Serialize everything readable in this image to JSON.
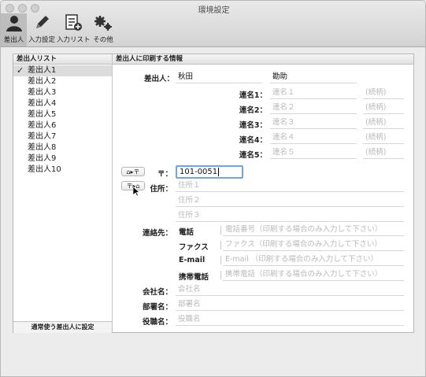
{
  "window": {
    "title": "環境設定"
  },
  "toolbar": [
    {
      "label": "差出人",
      "icon": "person-icon",
      "active": true
    },
    {
      "label": "入力設定",
      "icon": "pencil-icon",
      "active": false
    },
    {
      "label": "入力リスト",
      "icon": "list-add-icon",
      "active": false
    },
    {
      "label": "その他",
      "icon": "gears-icon",
      "active": false
    }
  ],
  "sender_list": {
    "header": "差出人リスト",
    "items": [
      "差出人1",
      "差出人2",
      "差出人3",
      "差出人4",
      "差出人5",
      "差出人6",
      "差出人7",
      "差出人8",
      "差出人9",
      "差出人10"
    ],
    "selected_index": 0,
    "default_button": "通常使う差出人に設定"
  },
  "detail": {
    "header": "差出人に印刷する情報",
    "sender_label": "差出人：",
    "last_name": "秋田",
    "first_name": "勘助",
    "renmei": [
      {
        "label": "連名1：",
        "placeholder": "連名１",
        "honorific": "(続柄)"
      },
      {
        "label": "連名2：",
        "placeholder": "連名２",
        "honorific": "(続柄)"
      },
      {
        "label": "連名3：",
        "placeholder": "連名３",
        "honorific": "(続柄)"
      },
      {
        "label": "連名4：",
        "placeholder": "連名４",
        "honorific": "(続柄)"
      },
      {
        "label": "連名5：",
        "placeholder": "連名５",
        "honorific": "(続柄)"
      }
    ],
    "zip_label": "〒：",
    "zip_value": "101-0051",
    "addr_to_zip_button": "⌂▸〒",
    "zip_to_addr_button": "〒▸⌂",
    "address_label": "住所：",
    "address_placeholders": [
      "住所１",
      "住所２",
      "住所３"
    ],
    "contact_label": "連絡先：",
    "contacts": [
      {
        "name": "電話",
        "placeholder": "電話番号（印刷する場合のみ入力して下さい）"
      },
      {
        "name": "ファクス",
        "placeholder": "ファクス（印刷する場合のみ入力して下さい）"
      },
      {
        "name": "E-mail",
        "placeholder": "E-mail （印刷する場合のみ入力して下さい）"
      },
      {
        "name": "携帯電話",
        "placeholder": "携帯電話（印刷する場合のみ入力して下さい）"
      }
    ],
    "company_label": "会社名：",
    "company_placeholder": "会社名",
    "dept_label": "部署名：",
    "dept_placeholder": "部署名",
    "title_label": "役職名：",
    "title_placeholder": "役職名"
  }
}
